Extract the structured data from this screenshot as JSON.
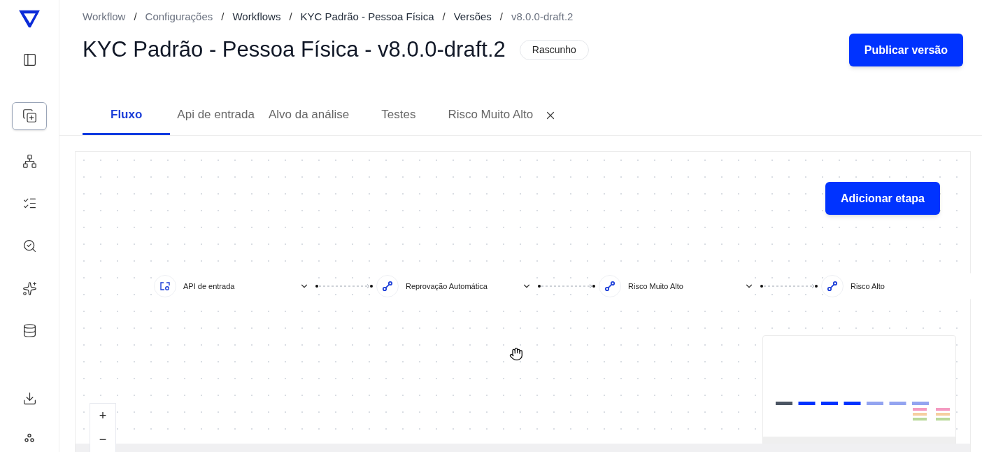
{
  "sidebar": {
    "items": [
      {
        "selected": false
      },
      {
        "selected": true
      },
      {
        "selected": false
      },
      {
        "selected": false
      },
      {
        "selected": false
      },
      {
        "selected": false
      },
      {
        "selected": false
      },
      {
        "selected": false
      },
      {
        "selected": false
      }
    ]
  },
  "breadcrumb": [
    {
      "label": "Workflow",
      "muted": true
    },
    {
      "label": "Configurações",
      "muted": true
    },
    {
      "label": "Workflows",
      "muted": false
    },
    {
      "label": "KYC Padrão - Pessoa Física",
      "muted": false
    },
    {
      "label": "Versões",
      "muted": false
    },
    {
      "label": "v8.0.0-draft.2",
      "muted": true
    }
  ],
  "separator": "/",
  "title": "KYC Padrão - Pessoa Física - v8.0.0-draft.2",
  "status_badge": "Rascunho",
  "publish_button": "Publicar versão",
  "tabs": [
    {
      "label": "Fluxo",
      "selected": true
    },
    {
      "label": "Api de entrada",
      "selected": false
    },
    {
      "label": "Alvo da análise",
      "selected": false
    },
    {
      "label": "Testes",
      "selected": false
    },
    {
      "label": "Risco Muito Alto",
      "selected": false,
      "closable": true
    }
  ],
  "add_step_button": "Adicionar etapa",
  "nodes": [
    {
      "label": "API de entrada",
      "kind": "api",
      "expanded": false
    },
    {
      "label": "Reprovação Automática",
      "kind": "route",
      "expanded": false
    },
    {
      "label": "Risco Muito Alto",
      "kind": "route",
      "expanded": false
    },
    {
      "label": "Risco Alto",
      "kind": "route"
    }
  ],
  "zoom_controls": [
    "+",
    "−"
  ]
}
